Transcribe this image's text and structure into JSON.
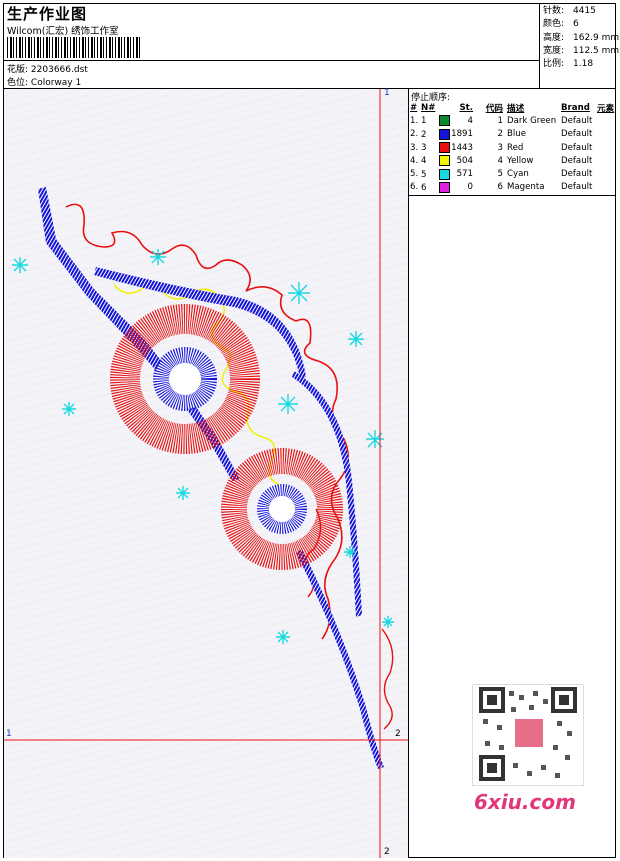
{
  "header": {
    "title": "生产作业图",
    "company": "Wilcom(汇宏) 绣饰工作室",
    "design_label": "花版:",
    "design_value": "2203666.dst",
    "colorway_label": "色位:",
    "colorway_value": "Colorway 1"
  },
  "stats": {
    "stitches_label": "针数:",
    "stitches": "4415",
    "colors_label": "颜色:",
    "colors": "6",
    "height_label": "高度:",
    "height": "162.9 mm",
    "width_label": "宽度:",
    "width": "112.5 mm",
    "scale_label": "比例:",
    "scale": "1.18"
  },
  "stop_table": {
    "title": "停止顺序:",
    "headers": [
      "#",
      "N#",
      "St.",
      "代码",
      "描述",
      "Brand",
      "元素"
    ],
    "rows": [
      {
        "idx": "1.",
        "n": "1",
        "st": "4",
        "code": "1",
        "desc": "Dark Green",
        "brand": "Default",
        "color": "#0a8a2a"
      },
      {
        "idx": "2.",
        "n": "2",
        "st": "1891",
        "code": "2",
        "desc": "Blue",
        "brand": "Default",
        "color": "#1414d8"
      },
      {
        "idx": "3.",
        "n": "3",
        "st": "1443",
        "code": "3",
        "desc": "Red",
        "brand": "Default",
        "color": "#e81010"
      },
      {
        "idx": "4.",
        "n": "4",
        "st": "504",
        "code": "4",
        "desc": "Yellow",
        "brand": "Default",
        "color": "#f4f400"
      },
      {
        "idx": "5.",
        "n": "5",
        "st": "571",
        "code": "5",
        "desc": "Cyan",
        "brand": "Default",
        "color": "#18d8e0"
      },
      {
        "idx": "6.",
        "n": "6",
        "st": "0",
        "code": "6",
        "desc": "Magenta",
        "brand": "Default",
        "color": "#e020e0"
      }
    ]
  },
  "markers": {
    "one": "1",
    "two": "2"
  },
  "watermark": "6xiu.com"
}
